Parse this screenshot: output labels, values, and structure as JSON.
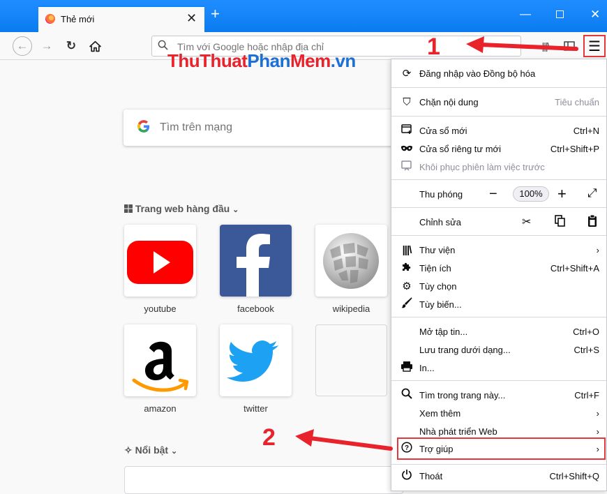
{
  "tab": {
    "title": "Thẻ mới"
  },
  "urlbar": {
    "placeholder": "Tìm với Google hoặc nhập địa chỉ"
  },
  "watermark": {
    "part1": "ThuThuat",
    "part2": "Phan",
    "part3": "Mem",
    "part4": ".vn"
  },
  "search": {
    "placeholder": "Tìm trên mạng"
  },
  "top_sites": {
    "header": "Trang web hàng đầu",
    "sites": [
      {
        "label": "youtube"
      },
      {
        "label": "facebook"
      },
      {
        "label": "wikipedia"
      },
      {
        "label": "amazon"
      },
      {
        "label": "twitter"
      }
    ]
  },
  "highlights": {
    "header": "Nổi bật"
  },
  "menu": {
    "sync": "Đăng nhập vào Đồng bộ hóa",
    "content_blocking": "Chặn nội dung",
    "content_blocking_value": "Tiêu chuẩn",
    "new_window": "Cửa sổ mới",
    "new_window_key": "Ctrl+N",
    "private_window": "Cửa sổ riêng tư mới",
    "private_window_key": "Ctrl+Shift+P",
    "restore_session": "Khôi phục phiên làm việc trước",
    "zoom": "Thu phóng",
    "zoom_value": "100%",
    "edit": "Chỉnh sửa",
    "library": "Thư viện",
    "addons": "Tiện ích",
    "addons_key": "Ctrl+Shift+A",
    "options": "Tùy chọn",
    "customize": "Tùy biến...",
    "open_file": "Mở tập tin...",
    "open_file_key": "Ctrl+O",
    "save_page": "Lưu trang dưới dạng...",
    "save_page_key": "Ctrl+S",
    "print": "In...",
    "find": "Tìm trong trang này...",
    "find_key": "Ctrl+F",
    "more": "Xem thêm",
    "web_developer": "Nhà phát triển Web",
    "help": "Trợ giúp",
    "quit": "Thoát",
    "quit_key": "Ctrl+Shift+Q"
  },
  "annotations": {
    "step1": "1",
    "step2": "2"
  },
  "colors": {
    "accent": "#0a84ff",
    "annotation": "#e8232b"
  }
}
